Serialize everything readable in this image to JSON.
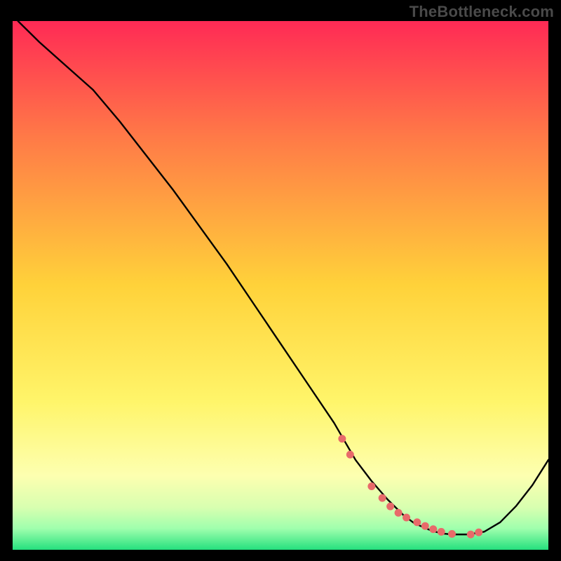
{
  "watermark": "TheBottleneck.com",
  "colors": {
    "background": "#000000",
    "curve": "#000000",
    "marker_fill": "#e86a6a",
    "marker_stroke": "#e86a6a",
    "grad_top": "#ff2a55",
    "grad_mid_upper": "#ff7a47",
    "grad_mid": "#ffd23a",
    "grad_mid_lower": "#fff56a",
    "grad_lower": "#fdffb0",
    "grad_band1": "#d8ffb0",
    "grad_band2": "#9fffad",
    "grad_bottom": "#25e07e"
  },
  "chart_data": {
    "type": "line",
    "title": "",
    "xlabel": "",
    "ylabel": "",
    "xlim": [
      0,
      100
    ],
    "ylim": [
      0,
      100
    ],
    "series": [
      {
        "name": "curve",
        "x": [
          1,
          5,
          10,
          15,
          20,
          25,
          30,
          35,
          40,
          45,
          50,
          55,
          60,
          62,
          64,
          67,
          70,
          73,
          75,
          78,
          80,
          82,
          85,
          88,
          91,
          94,
          97,
          100
        ],
        "y": [
          100,
          96,
          91.5,
          87,
          81,
          74.5,
          68,
          61,
          54,
          46.5,
          39,
          31.5,
          24,
          20.5,
          17,
          13,
          9.5,
          6.5,
          5,
          3.7,
          3.1,
          2.9,
          2.9,
          3.4,
          5.2,
          8.3,
          12.2,
          17
        ]
      }
    ],
    "markers": {
      "name": "bottom-markers",
      "x": [
        61.5,
        63,
        67,
        69,
        70.5,
        72,
        73.5,
        75.5,
        77,
        78.5,
        80,
        82,
        85.5,
        87
      ],
      "y": [
        21,
        18,
        12,
        9.8,
        8.2,
        7.0,
        6.1,
        5.2,
        4.5,
        3.9,
        3.4,
        3.0,
        2.9,
        3.3
      ]
    }
  }
}
